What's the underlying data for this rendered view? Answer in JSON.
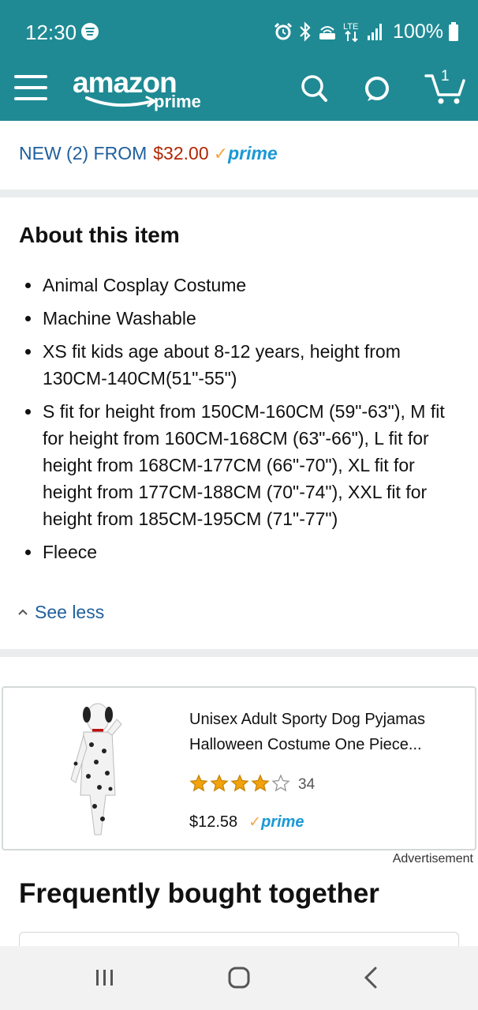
{
  "status_bar": {
    "time": "12:30",
    "battery": "100%",
    "icons": [
      "spotify-icon",
      "alarm-icon",
      "bluetooth-icon",
      "volte-icon",
      "lte-icon",
      "signal-icon",
      "battery-icon"
    ]
  },
  "header": {
    "logo_text": "amazon",
    "logo_sub": "prime",
    "cart_count": "1",
    "brand_color": "#1f8a94"
  },
  "offer": {
    "label": "NEW (2) FROM",
    "price": "$32.00",
    "prime_check": "✓",
    "prime_label": "prime"
  },
  "about": {
    "title": "About this item",
    "bullets": [
      "Animal Cosplay Costume",
      "Machine Washable",
      "XS fit kids age about 8-12 years, height from 130CM-140CM(51\"-55\")",
      "S fit for height from 150CM-160CM (59\"-63\"), M fit for height from 160CM-168CM (63\"-66\"), L fit for height from 168CM-177CM (66\"-70\"), XL fit for height from 177CM-188CM (70\"-74\"), XXL fit for height from 185CM-195CM (71\"-77\")",
      "Fleece"
    ],
    "see_less": "See less"
  },
  "ad": {
    "title": "Unisex Adult Sporty Dog Pyjamas Halloween Costume One Piece...",
    "rating": 4,
    "rating_max": 5,
    "review_count": "34",
    "price": "$12.58",
    "prime_check": "✓",
    "prime_label": "prime",
    "label": "Advertisement"
  },
  "fbt": {
    "title": "Frequently bought together"
  },
  "nav": {
    "icons": [
      "recent-apps-icon",
      "home-icon",
      "back-icon"
    ]
  }
}
